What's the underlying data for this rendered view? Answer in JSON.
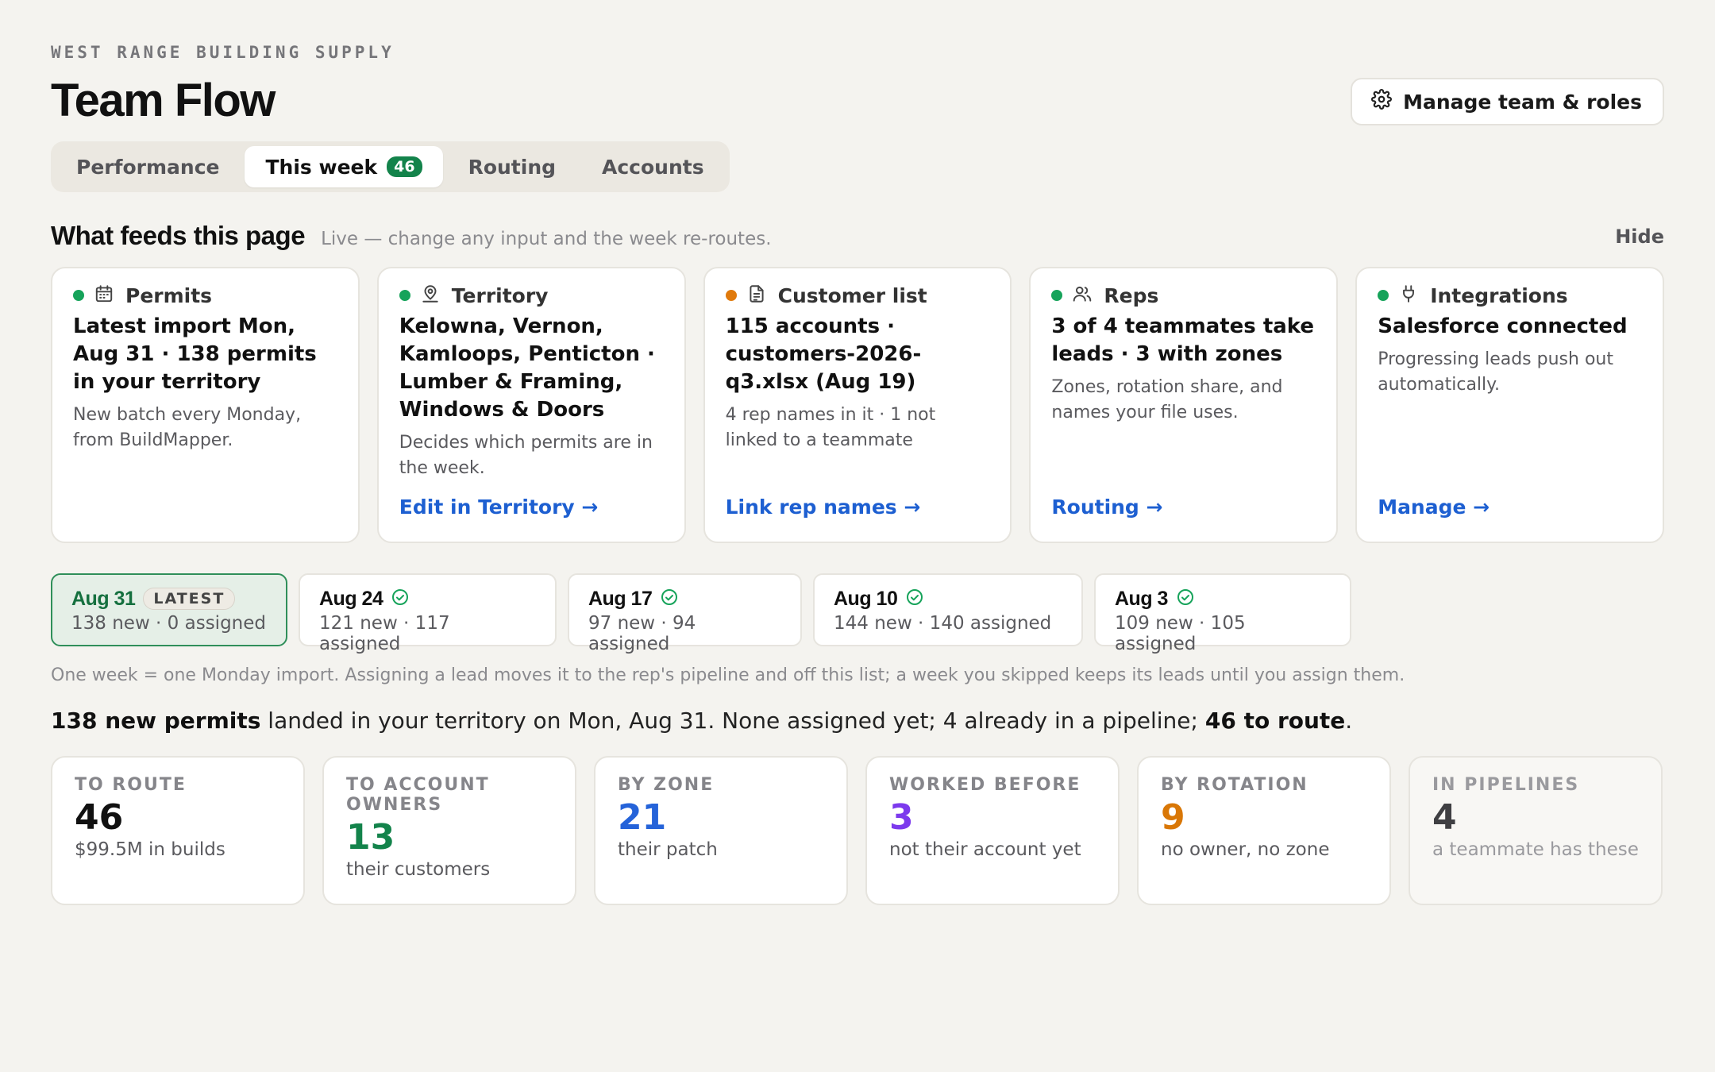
{
  "header": {
    "eyebrow": "WEST RANGE BUILDING SUPPLY",
    "title": "Team Flow",
    "manage_label": "Manage team & roles"
  },
  "tabs": [
    {
      "label": "Performance"
    },
    {
      "label": "This week",
      "count": "46"
    },
    {
      "label": "Routing"
    },
    {
      "label": "Accounts"
    }
  ],
  "feeds_section": {
    "title": "What feeds this page",
    "subtitle": "Live — change any input and the week re-routes.",
    "hide_label": "Hide"
  },
  "feeds": [
    {
      "label": "Permits",
      "status_color": "#16a35a",
      "icon": "calendar-icon",
      "main": "Latest import Mon, Aug 31 · 138 permits in your territory",
      "desc": "New batch every Monday, from BuildMapper.",
      "link": ""
    },
    {
      "label": "Territory",
      "status_color": "#16a35a",
      "icon": "map-pin-user-icon",
      "main": "Kelowna, Vernon, Kamloops, Penticton · Lumber & Framing, Windows & Doors",
      "desc": "Decides which permits are in the week.",
      "link": "Edit in Territory →"
    },
    {
      "label": "Customer list",
      "status_color": "#e07a0c",
      "icon": "document-icon",
      "main": "115 accounts · customers-2026-q3.xlsx (Aug 19)",
      "desc": "4 rep names in it · 1 not linked to a teammate",
      "link": "Link rep names →"
    },
    {
      "label": "Reps",
      "status_color": "#16a35a",
      "icon": "users-icon",
      "main": "3 of 4 teammates take leads · 3 with zones",
      "desc": "Zones, rotation share, and names your file uses.",
      "link": "Routing →"
    },
    {
      "label": "Integrations",
      "status_color": "#16a35a",
      "icon": "plug-icon",
      "main": "Salesforce connected",
      "desc": "Progressing leads push out automatically.",
      "link": "Manage →"
    }
  ],
  "weeks": [
    {
      "date": "Aug 31",
      "badge": "LATEST",
      "stats": "138 new · 0 assigned"
    },
    {
      "date": "Aug 24",
      "stats": "121 new · 117 assigned"
    },
    {
      "date": "Aug 17",
      "stats": "97 new · 94 assigned"
    },
    {
      "date": "Aug 10",
      "stats": "144 new · 140 assigned"
    },
    {
      "date": "Aug 3",
      "stats": "109 new · 105 assigned"
    }
  ],
  "weeks_note": "One week = one Monday import. Assigning a lead moves it to the rep's pipeline and off this list; a week you skipped keeps its leads until you assign them.",
  "summary": {
    "bold1": "138 new permits",
    "text1": " landed in your territory on Mon, Aug 31. None assigned yet; 4 already in a pipeline; ",
    "bold2": "46 to route",
    "text2": "."
  },
  "stats": [
    {
      "label": "TO ROUTE",
      "value": "46",
      "sub": "$99.5M in builds",
      "color": "#111111"
    },
    {
      "label": "TO ACCOUNT OWNERS",
      "value": "13",
      "sub": "their customers",
      "color": "#13834b"
    },
    {
      "label": "BY ZONE",
      "value": "21",
      "sub": "their patch",
      "color": "#2563d9"
    },
    {
      "label": "WORKED BEFORE",
      "value": "3",
      "sub": "not their account yet",
      "color": "#7c3aed"
    },
    {
      "label": "BY ROTATION",
      "value": "9",
      "sub": "no owner, no zone",
      "color": "#d97706"
    },
    {
      "label": "IN PIPELINES",
      "value": "4",
      "sub": "a teammate has these",
      "color": "#3f3f42"
    }
  ]
}
